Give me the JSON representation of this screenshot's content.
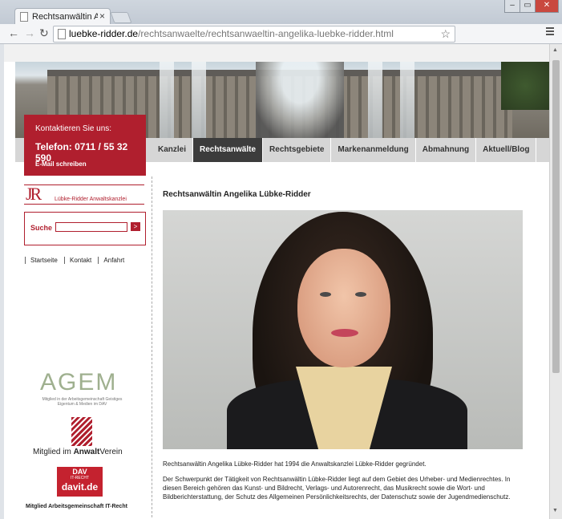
{
  "browser": {
    "tab_title": "Rechtsanwältin Angelika",
    "tab_close": "×",
    "url_domain": "luebke-ridder.de",
    "url_path": "/rechtsanwaelte/rechtsanwaeltin-angelika-luebke-ridder.html",
    "window_min": "–",
    "window_max": "▭",
    "window_close": "✕"
  },
  "contact": {
    "heading": "Kontaktieren Sie uns:",
    "phone": "Telefon: 0711 / 55 32 590",
    "email_link": "E-Mail schreiben"
  },
  "nav": {
    "items": [
      "Kanzlei",
      "Rechtsanwälte",
      "Rechtsgebiete",
      "Markenanmeldung",
      "Abmahnung",
      "Aktuell/Blog"
    ],
    "active": "Rechtsanwälte"
  },
  "logo": {
    "text": "Lübke-Ridder Anwaltskanzlei"
  },
  "search": {
    "label": "Suche",
    "button": ">"
  },
  "sublinks": [
    "Startseite",
    "Kontakt",
    "Anfahrt"
  ],
  "agem": {
    "name": "AGEM",
    "caption": "Mitglied in der Arbeitsgemeinschaft Geistiges Eigentum & Medien im DAV"
  },
  "anwaltverein": {
    "prefix": "Mitglied im ",
    "bold": "Anwalt",
    "suffix": "Verein"
  },
  "davit": {
    "line1": "DAV",
    "line2": "IT-RECHT",
    "line3": "davit.de",
    "caption": "Mitglied Arbeitsgemeinschaft IT-Recht"
  },
  "article": {
    "title": "Rechtsanwältin Angelika Lübke-Ridder",
    "p1": "Rechtsanwältin Angelika Lübke-Ridder hat 1994 die Anwaltskanzlei Lübke-Ridder gegründet.",
    "p2": "Der Schwerpunkt der Tätigkeit von Rechtsanwältin Lübke-Ridder liegt auf dem Gebiet des Urheber- und Medienrechtes. In diesen Bereich gehören das Kunst- und Bildrecht, Verlags- und Autorenrecht, das Musikrecht sowie die Wort- und Bildberichterstattung, der Schutz des Allgemeinen Persönlichkeitsrechts, der Datenschutz sowie der Jugendmedienschutz."
  },
  "colors": {
    "brand_red": "#b01f2e",
    "nav_active": "#3c3c3c"
  }
}
